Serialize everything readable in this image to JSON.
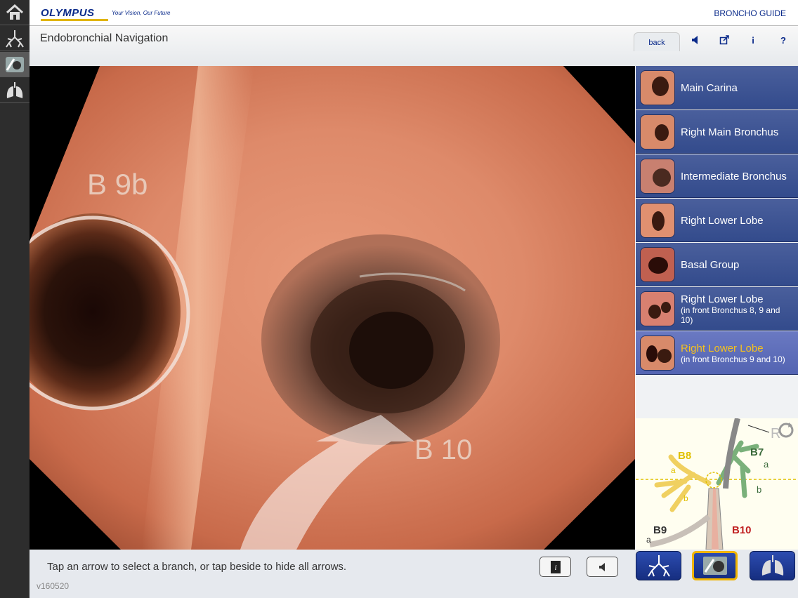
{
  "header": {
    "logo": "OLYMPUS",
    "tagline": "Your Vision, Our Future",
    "app_name": "BRONCHO GUIDE"
  },
  "subheader": {
    "title": "Endobronchial Navigation",
    "back_label": "back",
    "icons": [
      "speaker-icon",
      "external-link-icon",
      "info-icon",
      "help-icon"
    ],
    "help_label": "?",
    "info_label": "i"
  },
  "sidebar": {
    "icons": [
      "home-icon",
      "bronchial-tree-icon",
      "endoscope-view-icon",
      "lungs-icon"
    ],
    "active": "endoscope-view-icon"
  },
  "main_view": {
    "label_b9b": "B 9b",
    "label_b10": "B 10"
  },
  "nav": {
    "items": [
      {
        "label": "Main Carina",
        "sub": ""
      },
      {
        "label": "Right Main Bronchus",
        "sub": ""
      },
      {
        "label": "Intermediate Bronchus",
        "sub": ""
      },
      {
        "label": "Right Lower Lobe",
        "sub": ""
      },
      {
        "label": "Basal Group",
        "sub": ""
      },
      {
        "label": "Right Lower Lobe",
        "sub": "(in front Bronchus 8, 9 and 10)"
      },
      {
        "label": "Right Lower Lobe",
        "sub": "(in front Bronchus 9 and 10)"
      }
    ],
    "selected_index": 6
  },
  "map": {
    "labels": {
      "b8": "B8",
      "b7": "B7",
      "b9": "B9",
      "b10": "B10",
      "a1": "a",
      "a2": "a",
      "a3": "a",
      "b1": "b",
      "b2": "b",
      "r": "R"
    }
  },
  "bottom": {
    "hint": "Tap an arrow to select a branch, or tap beside to hide all arrows.",
    "version": "v160520"
  },
  "colors": {
    "brand": "#0a2a8a",
    "nav_bg": "#3b5192",
    "nav_selected_bg": "#5a6abb",
    "selected_text": "#f5c11d",
    "highlight_border": "#f0b400"
  }
}
